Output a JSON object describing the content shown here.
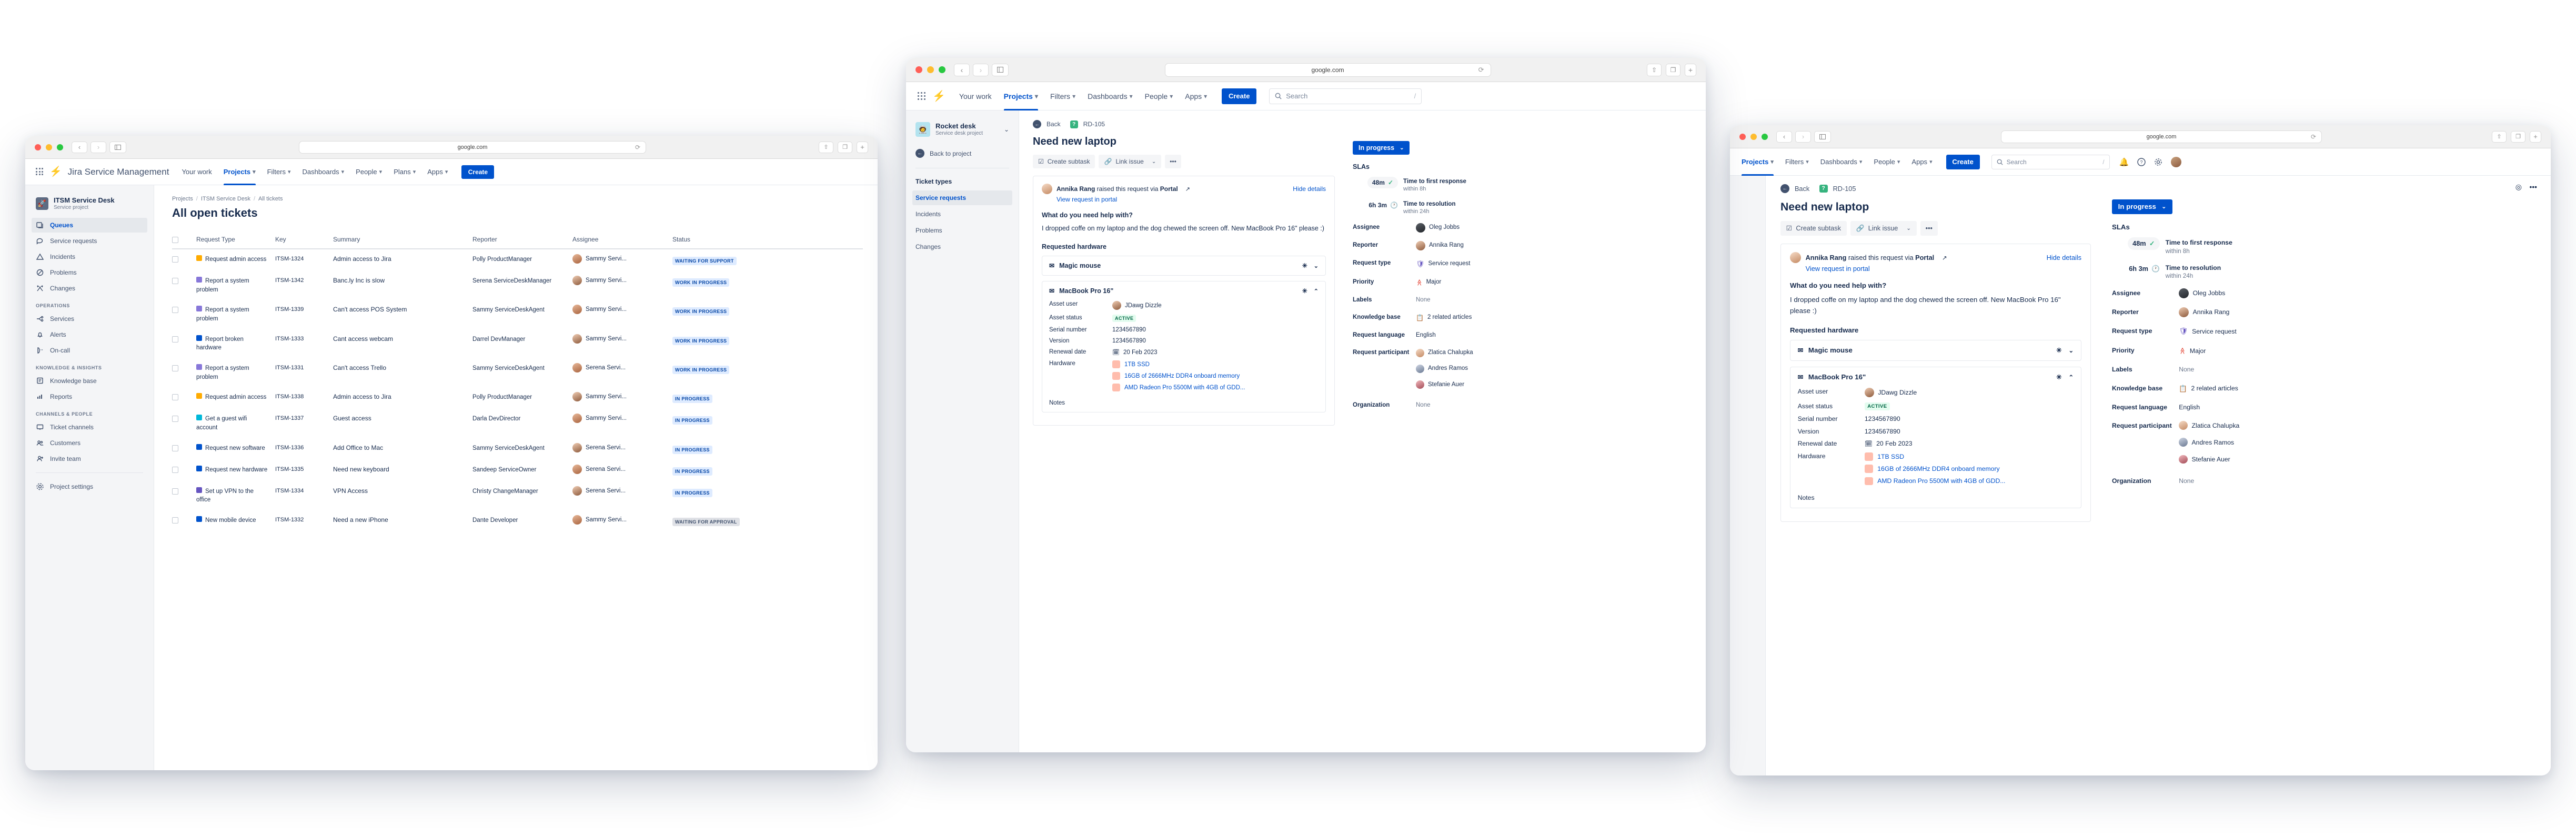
{
  "browser": {
    "url": "google.com"
  },
  "window1": {
    "nav": {
      "brand": "Jira Service Management",
      "items": [
        {
          "label": "Your work",
          "caret": false,
          "active": false
        },
        {
          "label": "Projects",
          "caret": true,
          "active": true
        },
        {
          "label": "Filters",
          "caret": true,
          "active": false
        },
        {
          "label": "Dashboards",
          "caret": true,
          "active": false
        },
        {
          "label": "People",
          "caret": true,
          "active": false
        },
        {
          "label": "Plans",
          "caret": true,
          "active": false
        },
        {
          "label": "Apps",
          "caret": true,
          "active": false
        }
      ],
      "create_label": "Create"
    },
    "sidebar": {
      "project_name": "ITSM Service Desk",
      "project_sub": "Service project",
      "groups": [
        {
          "title": "",
          "items": [
            {
              "label": "Queues",
              "icon": "queues-icon",
              "active": true
            },
            {
              "label": "Service requests",
              "icon": "chat-icon",
              "active": false
            },
            {
              "label": "Incidents",
              "icon": "warning-triangle-icon",
              "active": false
            },
            {
              "label": "Problems",
              "icon": "no-entry-icon",
              "active": false
            },
            {
              "label": "Changes",
              "icon": "change-arrows-icon",
              "active": false
            }
          ]
        },
        {
          "title": "OPERATIONS",
          "items": [
            {
              "label": "Services",
              "icon": "services-nodes-icon",
              "active": false
            },
            {
              "label": "Alerts",
              "icon": "bell-icon",
              "active": false
            },
            {
              "label": "On-call",
              "icon": "phone-icon",
              "active": false
            }
          ]
        },
        {
          "title": "KNOWLEDGE & INSIGHTS",
          "items": [
            {
              "label": "Knowledge base",
              "icon": "book-icon",
              "active": false
            },
            {
              "label": "Reports",
              "icon": "bar-chart-icon",
              "active": false
            }
          ]
        },
        {
          "title": "CHANNELS & PEOPLE",
          "items": [
            {
              "label": "Ticket channels",
              "icon": "monitor-icon",
              "active": false
            },
            {
              "label": "Customers",
              "icon": "people-group-icon",
              "active": false
            },
            {
              "label": "Invite team",
              "icon": "person-add-icon",
              "active": false
            }
          ]
        }
      ],
      "footer_item": {
        "label": "Project settings",
        "icon": "gear-icon"
      }
    },
    "breadcrumb": [
      "Projects",
      "ITSM Service Desk",
      "All tickets"
    ],
    "page_title": "All open tickets",
    "table": {
      "columns": [
        "Request Type",
        "Key",
        "Summary",
        "Reporter",
        "Assignee",
        "Status"
      ],
      "rows": [
        {
          "type": "Request admin access",
          "type_icon": "arrow-up-icon",
          "type_color": "#ffab00",
          "key": "ITSM-1324",
          "summary": "Admin access to Jira",
          "reporter": "Polly ProductManager",
          "assignee": "Sammy Servi...",
          "status": "WAITING FOR SUPPORT",
          "status_style": "blue"
        },
        {
          "type": "Report a system problem",
          "type_icon": "person-icon",
          "type_color": "#8777d9",
          "key": "ITSM-1342",
          "summary": "Banc.ly Inc is slow",
          "reporter": "Serena ServiceDeskManager",
          "assignee": "Sammy Servi...",
          "status": "WORK IN PROGRESS",
          "status_style": "blue"
        },
        {
          "type": "Report a system problem",
          "type_icon": "person-icon",
          "type_color": "#8777d9",
          "key": "ITSM-1339",
          "summary": "Can't access POS System",
          "reporter": "Sammy ServiceDeskAgent",
          "assignee": "Sammy Servi...",
          "status": "WORK IN PROGRESS",
          "status_style": "blue"
        },
        {
          "type": "Report broken hardware",
          "type_icon": "broken-hardware-icon",
          "type_color": "#0052cc",
          "key": "ITSM-1333",
          "summary": "Cant access webcam",
          "reporter": "Darrel DevManager",
          "assignee": "Sammy Servi...",
          "status": "WORK IN PROGRESS",
          "status_style": "blue"
        },
        {
          "type": "Report a system problem",
          "type_icon": "person-icon",
          "type_color": "#8777d9",
          "key": "ITSM-1331",
          "summary": "Can't access Trello",
          "reporter": "Sammy ServiceDeskAgent",
          "assignee": "Serena Servi...",
          "status": "WORK IN PROGRESS",
          "status_style": "blue"
        },
        {
          "type": "Request admin access",
          "type_icon": "arrow-up-icon",
          "type_color": "#ffab00",
          "key": "ITSM-1338",
          "summary": "Admin access to Jira",
          "reporter": "Polly ProductManager",
          "assignee": "Sammy Servi...",
          "status": "IN PROGRESS",
          "status_style": "blue"
        },
        {
          "type": "Get a guest wifi account",
          "type_icon": "wifi-funnel-icon",
          "type_color": "#00b8d9",
          "key": "ITSM-1337",
          "summary": "Guest access",
          "reporter": "Darla DevDirector",
          "assignee": "Sammy Servi...",
          "status": "IN PROGRESS",
          "status_style": "blue"
        },
        {
          "type": "Request new software",
          "type_icon": "software-icon",
          "type_color": "#0052cc",
          "key": "ITSM-1336",
          "summary": "Add Office to Mac",
          "reporter": "Sammy ServiceDeskAgent",
          "assignee": "Serena Servi...",
          "status": "IN PROGRESS",
          "status_style": "blue"
        },
        {
          "type": "Request new hardware",
          "type_icon": "hardware-icon",
          "type_color": "#0052cc",
          "key": "ITSM-1335",
          "summary": "Need new keyboard",
          "reporter": "Sandeep ServiceOwner",
          "assignee": "Serena Servi...",
          "status": "IN PROGRESS",
          "status_style": "blue"
        },
        {
          "type": "Set up VPN to the office",
          "type_icon": "vpn-icon",
          "type_color": "#6554c0",
          "key": "ITSM-1334",
          "summary": "VPN Access",
          "reporter": "Christy ChangeManager",
          "assignee": "Serena Servi...",
          "status": "IN PROGRESS",
          "status_style": "blue"
        },
        {
          "type": "New mobile device",
          "type_icon": "mobile-icon",
          "type_color": "#0052cc",
          "key": "ITSM-1332",
          "summary": "Need a new iPhone",
          "reporter": "Dante Developer",
          "assignee": "Sammy Servi...",
          "status": "WAITING FOR APPROVAL",
          "status_style": "grey"
        }
      ]
    }
  },
  "issue": {
    "nav": {
      "items": [
        {
          "label": "Your work",
          "caret": false,
          "active": false
        },
        {
          "label": "Projects",
          "caret": true,
          "active": true
        },
        {
          "label": "Filters",
          "caret": true,
          "active": false
        },
        {
          "label": "Dashboards",
          "caret": true,
          "active": false
        },
        {
          "label": "People",
          "caret": true,
          "active": false
        },
        {
          "label": "Apps",
          "caret": true,
          "active": false
        }
      ],
      "create_label": "Create",
      "search_placeholder": "Search",
      "search_shortcut": "/"
    },
    "sidebar": {
      "project_name": "Rocket desk",
      "project_sub": "Service desk project",
      "back_label": "Back to project",
      "section_title": "Ticket types",
      "items": [
        {
          "label": "Service requests",
          "active": true
        },
        {
          "label": "Incidents",
          "active": false
        },
        {
          "label": "Problems",
          "active": false
        },
        {
          "label": "Changes",
          "active": false
        }
      ]
    },
    "back_label": "Back",
    "issue_key": "RD-105",
    "title": "Need new laptop",
    "actions": {
      "create_subtask": "Create subtask",
      "link_issue": "Link issue",
      "more": "•••"
    },
    "reporter_line": {
      "name": "Annika Rang",
      "mid": "raised this request via",
      "channel": "Portal"
    },
    "portal_link": "View request in portal",
    "hide_details": "Hide details",
    "question_label": "What do you need help with?",
    "question_body": "I dropped coffe on my laptop and the dog chewed the screen off. New MacBook Pro 16\" please :)",
    "requested_hardware_label": "Requested hardware",
    "assets": [
      {
        "name": "Magic mouse",
        "expanded": false
      },
      {
        "name": "MacBook Pro 16\"",
        "expanded": true,
        "fields": [
          {
            "label": "Asset user",
            "value": "JDawg Dizzle",
            "kind": "avatar"
          },
          {
            "label": "Asset status",
            "value": "ACTIVE",
            "kind": "chip"
          },
          {
            "label": "Serial number",
            "value": "1234567890",
            "kind": "text"
          },
          {
            "label": "Version",
            "value": "1234567890",
            "kind": "text"
          },
          {
            "label": "Renewal date",
            "value": "20 Feb 2023",
            "kind": "date"
          }
        ],
        "hardware_label": "Hardware",
        "hardware": [
          "1TB SSD",
          "16GB of 2666MHz DDR4 onboard memory",
          "AMD Radeon Pro 5500M with 4GB of GDD..."
        ],
        "hardware_full": [
          "1TB SSD",
          "16GB of 2666MHz DDR4 onboard memory",
          "AMD Radeon Pro 5500M with 4GB of GDD..."
        ],
        "notes_label": "Notes"
      }
    ],
    "details": {
      "status": "In progress",
      "slas_label": "SLAs",
      "slas": [
        {
          "time": "48m",
          "state": "met",
          "name": "Time to first response",
          "sub": "within 8h"
        },
        {
          "time": "6h 3m",
          "state": "running",
          "name": "Time to resolution",
          "sub": "within 24h"
        }
      ],
      "fields": [
        {
          "label": "Assignee",
          "value": "Oleg Jobbs",
          "kind": "avatar"
        },
        {
          "label": "Reporter",
          "value": "Annika Rang",
          "kind": "avatar"
        },
        {
          "label": "Request type",
          "value": "Service request",
          "kind": "shield"
        },
        {
          "label": "Priority",
          "value": "Major",
          "kind": "priority"
        },
        {
          "label": "Labels",
          "value": "None",
          "kind": "muted"
        },
        {
          "label": "Knowledge base",
          "value": "2 related articles",
          "kind": "kb"
        },
        {
          "label": "Request language",
          "value": "English",
          "kind": "text"
        },
        {
          "label": "Request participant",
          "value": "Zlatica Chalupka",
          "kind": "participants",
          "participants": [
            "Zlatica Chalupka",
            "Andres Ramos",
            "Stefanie Auer"
          ]
        },
        {
          "label": "Organization",
          "value": "None",
          "kind": "muted"
        }
      ]
    }
  }
}
